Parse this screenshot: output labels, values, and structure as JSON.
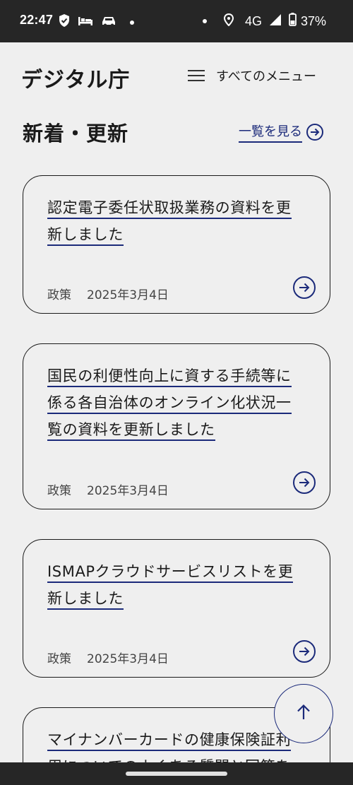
{
  "status_bar": {
    "time": "22:47",
    "network": "4G",
    "battery": "37%",
    "icons_left": [
      "shield-check-icon",
      "bed-icon",
      "car-icon",
      "notification-dot-icon"
    ],
    "icons_right": [
      "notification-dot-icon",
      "location-icon",
      "signal-icon",
      "battery-icon"
    ]
  },
  "header": {
    "logo": "デジタル庁",
    "menu_label": "すべてのメニュー"
  },
  "section": {
    "title": "新着・更新",
    "see_all_label": "一覧を見る"
  },
  "cards": [
    {
      "title_lines": [
        "認定電子委任状取扱業務の資料を更",
        "新しました"
      ],
      "category": "政策",
      "date": "2025年3月4日"
    },
    {
      "title_lines": [
        "国民の利便性向上に資する手続等に",
        "係る各自治体のオンライン化状況一",
        "覧の資料を更新しました"
      ],
      "category": "政策",
      "date": "2025年3月4日"
    },
    {
      "title_lines": [
        "ISMAPクラウドサービスリストを更",
        "新しました"
      ],
      "category": "政策",
      "date": "2025年3月4日"
    },
    {
      "title_lines": [
        "マイナンバーカードの健康保険証利",
        "用についてのよくある質問と回答を"
      ],
      "category": "",
      "date": ""
    }
  ],
  "colors": {
    "accent": "#1b2a7a",
    "background": "#efefef",
    "text": "#1a1a1a",
    "status_bar": "#262626"
  }
}
